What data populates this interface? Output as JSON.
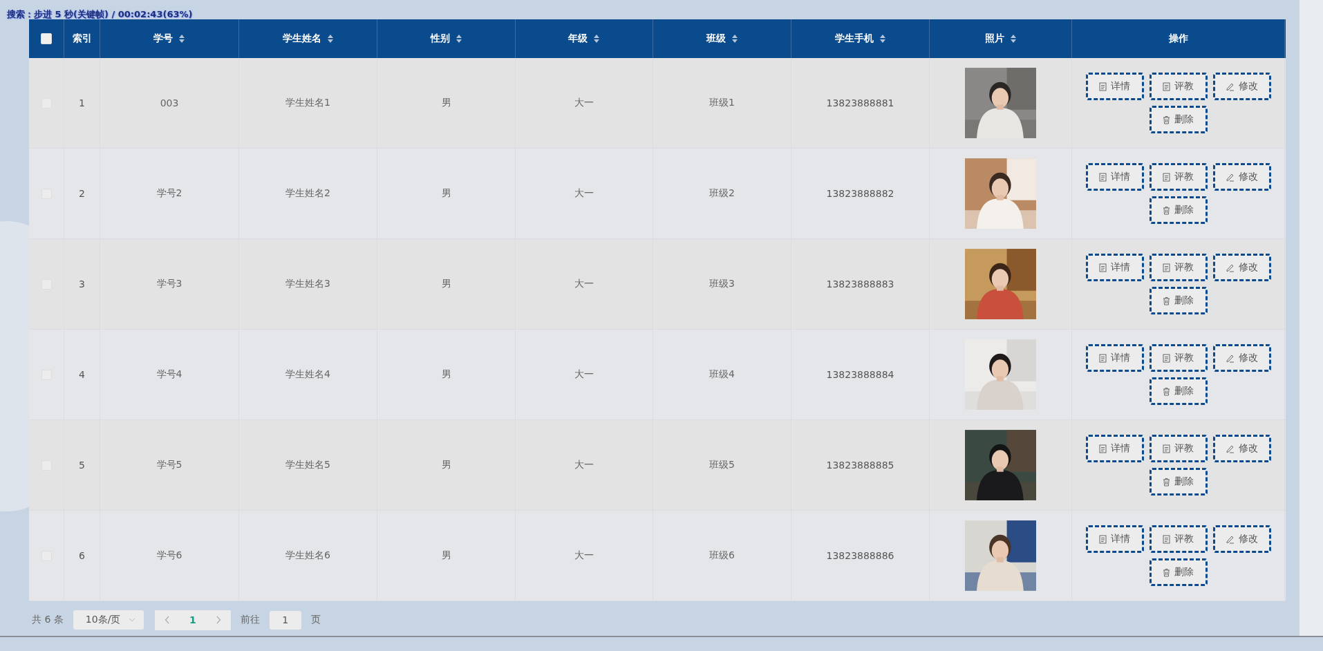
{
  "osd": "搜索：步进 5 秒(关键帧) / 00:02:43(63%)",
  "table": {
    "select_all_checked": false,
    "columns": [
      {
        "label": "索引",
        "sortable": false
      },
      {
        "label": "学号",
        "sortable": true
      },
      {
        "label": "学生姓名",
        "sortable": true
      },
      {
        "label": "性别",
        "sortable": true
      },
      {
        "label": "年级",
        "sortable": true
      },
      {
        "label": "班级",
        "sortable": true
      },
      {
        "label": "学生手机",
        "sortable": true
      },
      {
        "label": "照片",
        "sortable": true
      },
      {
        "label": "操作",
        "sortable": false
      }
    ],
    "rows": [
      {
        "checked": false,
        "cells": [
          "1",
          "003",
          "学生姓名1",
          "男",
          "大一",
          "班级1",
          "13823888881"
        ],
        "actions": [
          {
            "kind": "doc",
            "label": "详情"
          },
          {
            "kind": "doc",
            "label": "评教"
          },
          {
            "kind": "edit",
            "label": "修改"
          },
          {
            "kind": "delete",
            "label": "删除"
          }
        ]
      },
      {
        "checked": false,
        "cells": [
          "2",
          "学号2",
          "学生姓名2",
          "男",
          "大一",
          "班级2",
          "13823888882"
        ],
        "actions": [
          {
            "kind": "doc",
            "label": "详情"
          },
          {
            "kind": "doc",
            "label": "评教"
          },
          {
            "kind": "edit",
            "label": "修改"
          },
          {
            "kind": "delete",
            "label": "删除"
          }
        ]
      },
      {
        "checked": false,
        "cells": [
          "3",
          "学号3",
          "学生姓名3",
          "男",
          "大一",
          "班级3",
          "13823888883"
        ],
        "actions": [
          {
            "kind": "doc",
            "label": "详情"
          },
          {
            "kind": "doc",
            "label": "评教"
          },
          {
            "kind": "edit",
            "label": "修改"
          },
          {
            "kind": "delete",
            "label": "删除"
          }
        ]
      },
      {
        "checked": false,
        "cells": [
          "4",
          "学号4",
          "学生姓名4",
          "男",
          "大一",
          "班级4",
          "13823888884"
        ],
        "actions": [
          {
            "kind": "doc",
            "label": "详情"
          },
          {
            "kind": "doc",
            "label": "评教"
          },
          {
            "kind": "edit",
            "label": "修改"
          },
          {
            "kind": "delete",
            "label": "删除"
          }
        ]
      },
      {
        "checked": false,
        "cells": [
          "5",
          "学号5",
          "学生姓名5",
          "男",
          "大一",
          "班级5",
          "13823888885"
        ],
        "actions": [
          {
            "kind": "doc",
            "label": "详情"
          },
          {
            "kind": "doc",
            "label": "评教"
          },
          {
            "kind": "edit",
            "label": "修改"
          },
          {
            "kind": "delete",
            "label": "删除"
          }
        ]
      },
      {
        "checked": false,
        "cells": [
          "6",
          "学号6",
          "学生姓名6",
          "男",
          "大一",
          "班级6",
          "13823888886"
        ],
        "actions": [
          {
            "kind": "doc",
            "label": "详情"
          },
          {
            "kind": "doc",
            "label": "评教"
          },
          {
            "kind": "edit",
            "label": "修改"
          },
          {
            "kind": "delete",
            "label": "删除"
          }
        ]
      }
    ]
  },
  "pagination": {
    "total": "共 6 条",
    "page_size": "10条/页",
    "pages": [
      {
        "label": "1",
        "selected": true
      }
    ],
    "goto_label": "前往",
    "goto_value": "1",
    "goto_suffix": "页"
  }
}
